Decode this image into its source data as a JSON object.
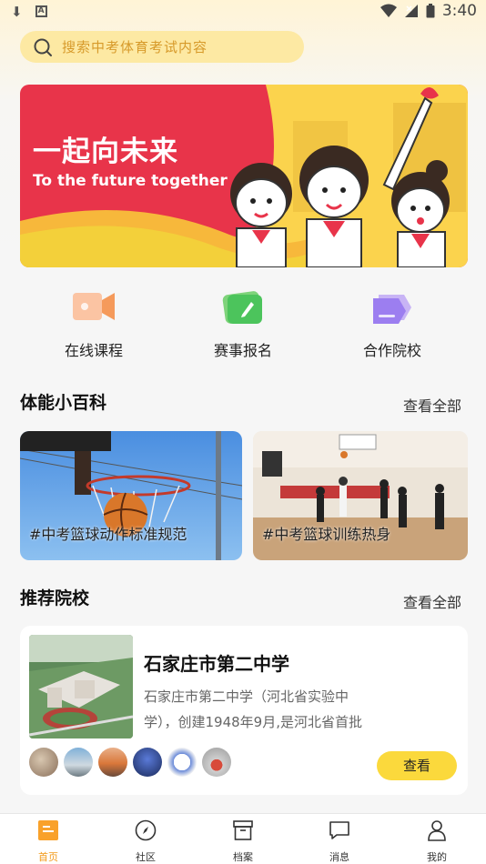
{
  "status_bar": {
    "time": "3:40"
  },
  "search": {
    "placeholder": "搜索中考体育考试内容"
  },
  "banner": {
    "title": "一起向未来",
    "subtitle": "To the future together"
  },
  "quick_actions": [
    {
      "label": "在线课程",
      "icon": "video-camera-icon"
    },
    {
      "label": "赛事报名",
      "icon": "edit-note-icon"
    },
    {
      "label": "合作院校",
      "icon": "school-stack-icon"
    }
  ],
  "encyclopedia": {
    "title": "体能小百科",
    "see_all": "查看全部",
    "cards": [
      {
        "tag": "#中考篮球动作标准规范"
      },
      {
        "tag": "#中考篮球训练热身"
      }
    ]
  },
  "recommended": {
    "title": "推荐院校",
    "see_all": "查看全部",
    "school": {
      "name": "石家庄市第二中学",
      "desc": "石家庄市第二中学（河北省实验中学），创建1948年9月,是河北省首批",
      "button": "查看"
    }
  },
  "tabbar": [
    {
      "label": "首页",
      "active": true
    },
    {
      "label": "社区"
    },
    {
      "label": "档案"
    },
    {
      "label": "消息"
    },
    {
      "label": "我的"
    }
  ],
  "colors": {
    "accent": "#f29a1a",
    "button": "#fbd93c",
    "search_bg": "#fde9a3"
  }
}
